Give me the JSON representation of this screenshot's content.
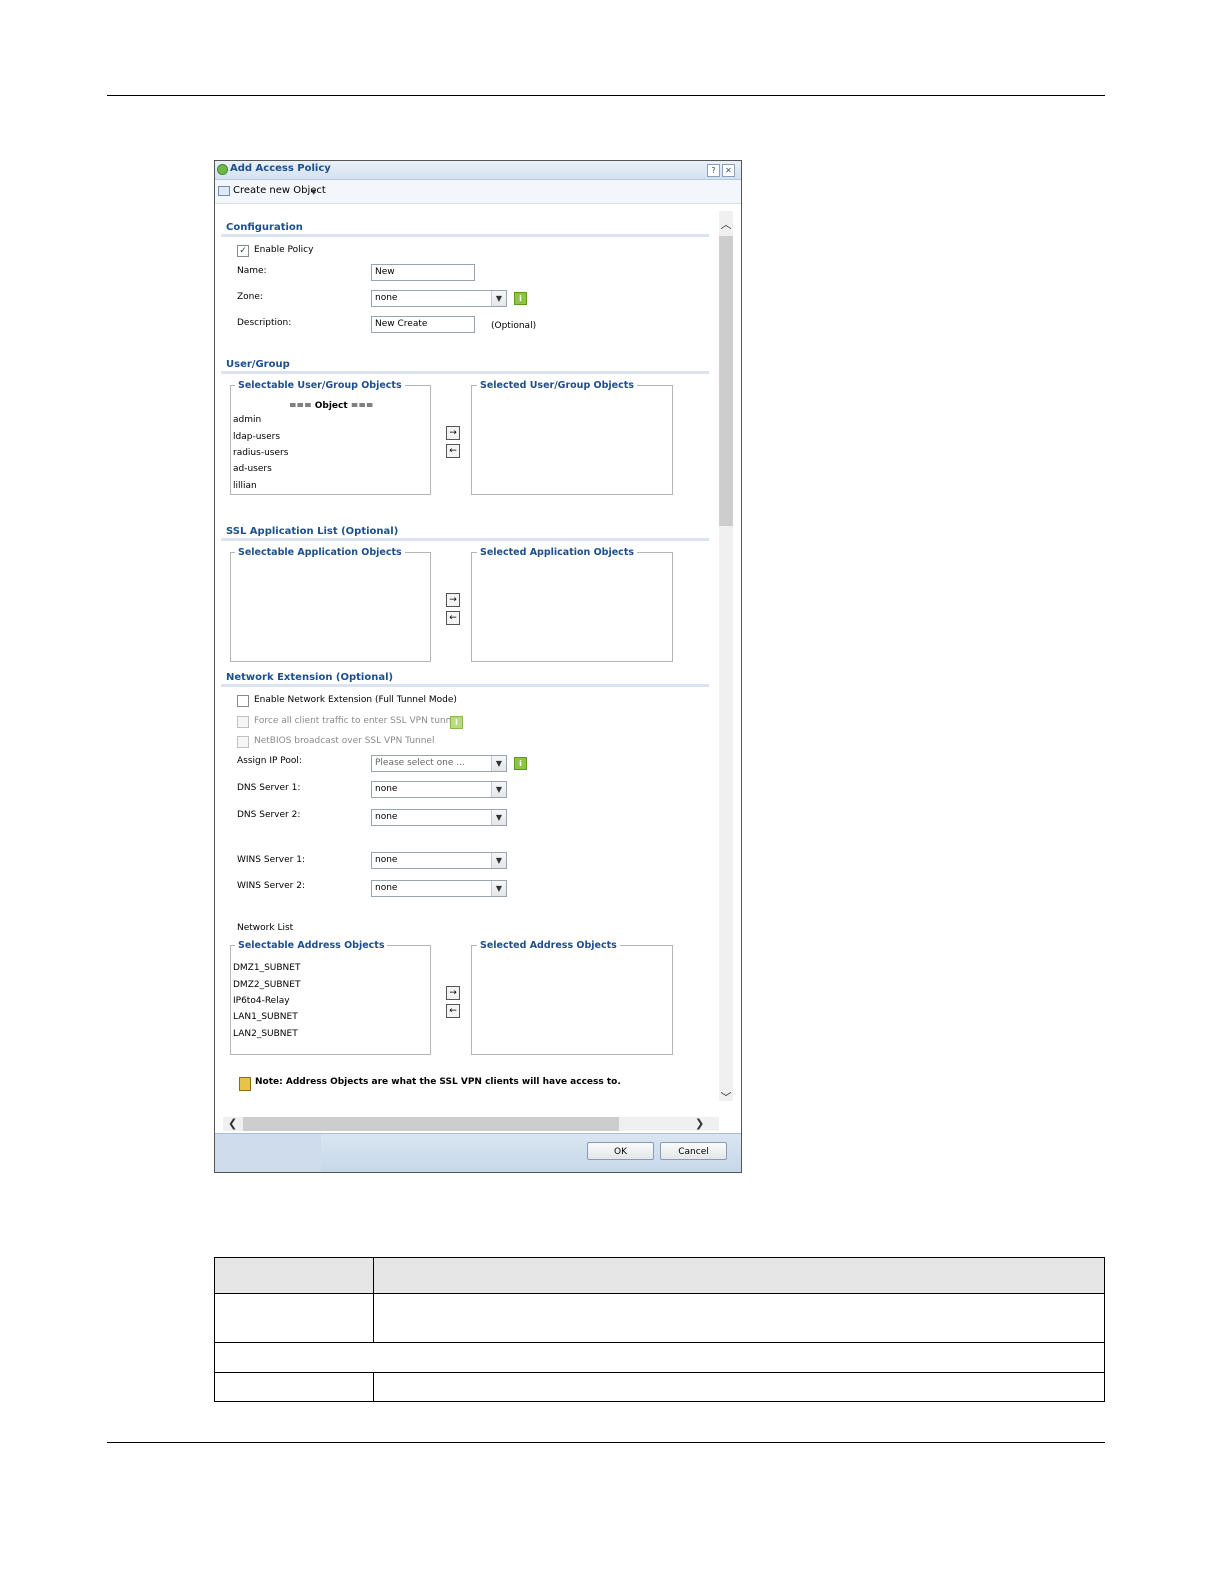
{
  "dialog": {
    "title": "Add Access Policy",
    "help_label": "?",
    "close_label": "✕",
    "toolbar": {
      "create_label": "Create new Object"
    },
    "sections": {
      "configuration": "Configuration",
      "user_group": "User/Group",
      "ssl_app": "SSL Application List (Optional)",
      "network_ext": "Network Extension (Optional)"
    },
    "config": {
      "enable_policy_label": "Enable Policy",
      "enable_policy_checked": true,
      "name_label": "Name:",
      "name_value": "New",
      "zone_label": "Zone:",
      "zone_value": "none",
      "description_label": "Description:",
      "description_value": "New Create",
      "optional_label": "(Optional)"
    },
    "user_group": {
      "selectable_legend": "Selectable User/Group Objects",
      "selected_legend": "Selected User/Group Objects",
      "list_header": "=== Object ===",
      "items": [
        "admin",
        "ldap-users",
        "radius-users",
        "ad-users",
        "lillian"
      ]
    },
    "ssl_app": {
      "selectable_legend": "Selectable Application Objects",
      "selected_legend": "Selected Application Objects"
    },
    "network_ext": {
      "enable_label": "Enable Network Extension (Full Tunnel Mode)",
      "force_label": "Force all client traffic to enter SSL VPN tunnel",
      "netbios_label": "NetBIOS broadcast over SSL VPN Tunnel",
      "assign_pool_label": "Assign IP Pool:",
      "assign_pool_value": "Please select one ...",
      "dns1_label": "DNS Server 1:",
      "dns1_value": "none",
      "dns2_label": "DNS Server 2:",
      "dns2_value": "none",
      "wins1_label": "WINS Server 1:",
      "wins1_value": "none",
      "wins2_label": "WINS Server 2:",
      "wins2_value": "none",
      "network_list_label": "Network List",
      "selectable_legend": "Selectable Address Objects",
      "selected_legend": "Selected Address Objects",
      "address_items": [
        "DMZ1_SUBNET",
        "DMZ2_SUBNET",
        "IP6to4-Relay",
        "LAN1_SUBNET",
        "LAN2_SUBNET"
      ]
    },
    "note": "Note: Address Objects are what the SSL VPN clients will have access to.",
    "buttons": {
      "ok": "OK",
      "cancel": "Cancel"
    }
  }
}
